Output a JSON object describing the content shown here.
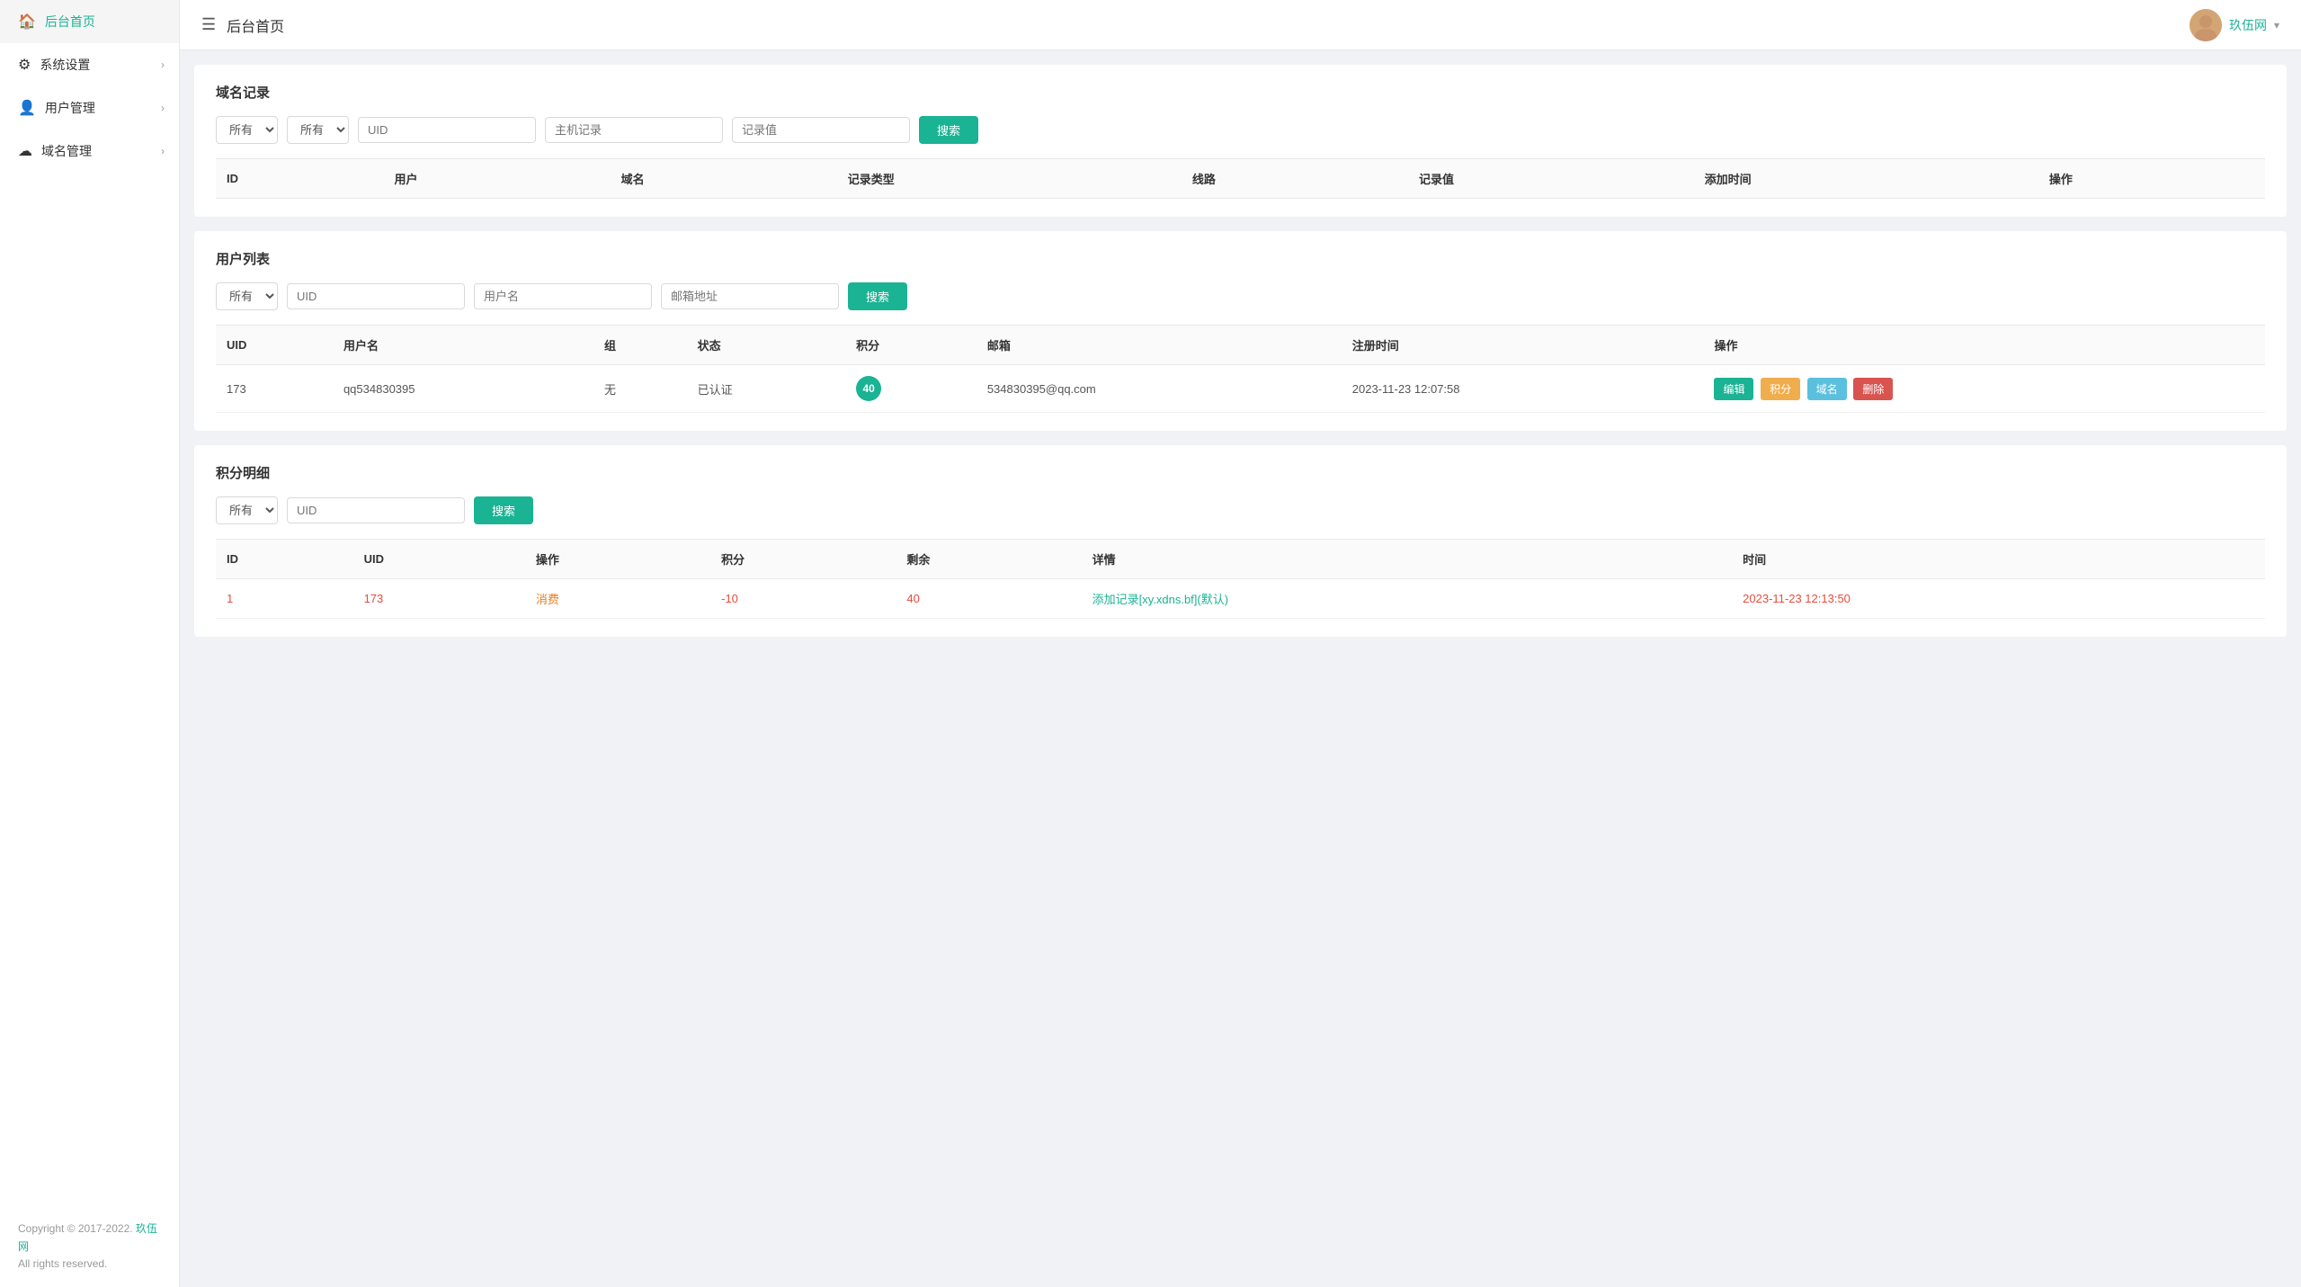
{
  "sidebar": {
    "items": [
      {
        "id": "home",
        "label": "后台首页",
        "icon": "🏠",
        "hasArrow": false,
        "active": true
      },
      {
        "id": "settings",
        "label": "系统设置",
        "icon": "⚙",
        "hasArrow": true,
        "active": false
      },
      {
        "id": "users",
        "label": "用户管理",
        "icon": "👤",
        "hasArrow": true,
        "active": false
      },
      {
        "id": "domains",
        "label": "域名管理",
        "icon": "🌐",
        "hasArrow": true,
        "active": false
      }
    ],
    "footer": {
      "copyright": "Copyright © 2017-2022. ",
      "brand": "玖伍网",
      "rights": "All rights reserved."
    }
  },
  "topbar": {
    "menu_icon": "☰",
    "title": "后台首页",
    "username": "玖伍网",
    "dropdown_icon": "▾"
  },
  "domain_records": {
    "panel_title": "域名记录",
    "filters": {
      "select1_options": [
        "所有"
      ],
      "select1_value": "所有",
      "select2_options": [
        "所有"
      ],
      "select2_value": "所有",
      "uid_placeholder": "UID",
      "host_placeholder": "主机记录",
      "value_placeholder": "记录值",
      "search_label": "搜索"
    },
    "columns": [
      "ID",
      "用户",
      "域名",
      "记录类型",
      "线路",
      "记录值",
      "添加时间",
      "操作"
    ],
    "rows": []
  },
  "user_list": {
    "panel_title": "用户列表",
    "filters": {
      "select_options": [
        "所有"
      ],
      "select_value": "所有",
      "uid_placeholder": "UID",
      "username_placeholder": "用户名",
      "email_placeholder": "邮箱地址",
      "search_label": "搜索"
    },
    "columns": [
      "UID",
      "用户名",
      "组",
      "状态",
      "积分",
      "邮箱",
      "注册时间",
      "操作"
    ],
    "rows": [
      {
        "uid": "173",
        "username": "qq534830395",
        "group": "无",
        "status": "已认证",
        "points": "40",
        "email": "534830395@qq.com",
        "reg_time": "2023-11-23 12:07:58",
        "actions": {
          "edit": "编辑",
          "points": "积分",
          "domain": "域名",
          "delete": "删除"
        }
      }
    ]
  },
  "points_detail": {
    "panel_title": "积分明细",
    "filters": {
      "select_options": [
        "所有"
      ],
      "select_value": "所有",
      "uid_placeholder": "UID",
      "search_label": "搜索"
    },
    "columns": [
      "ID",
      "UID",
      "操作",
      "积分",
      "剩余",
      "详情",
      "时间"
    ],
    "rows": [
      {
        "id": "1",
        "uid": "173",
        "operation": "消费",
        "points": "-10",
        "remaining": "40",
        "detail": "添加记录[xy.xdns.bf](默认)",
        "time": "2023-11-23 12:13:50"
      }
    ]
  }
}
